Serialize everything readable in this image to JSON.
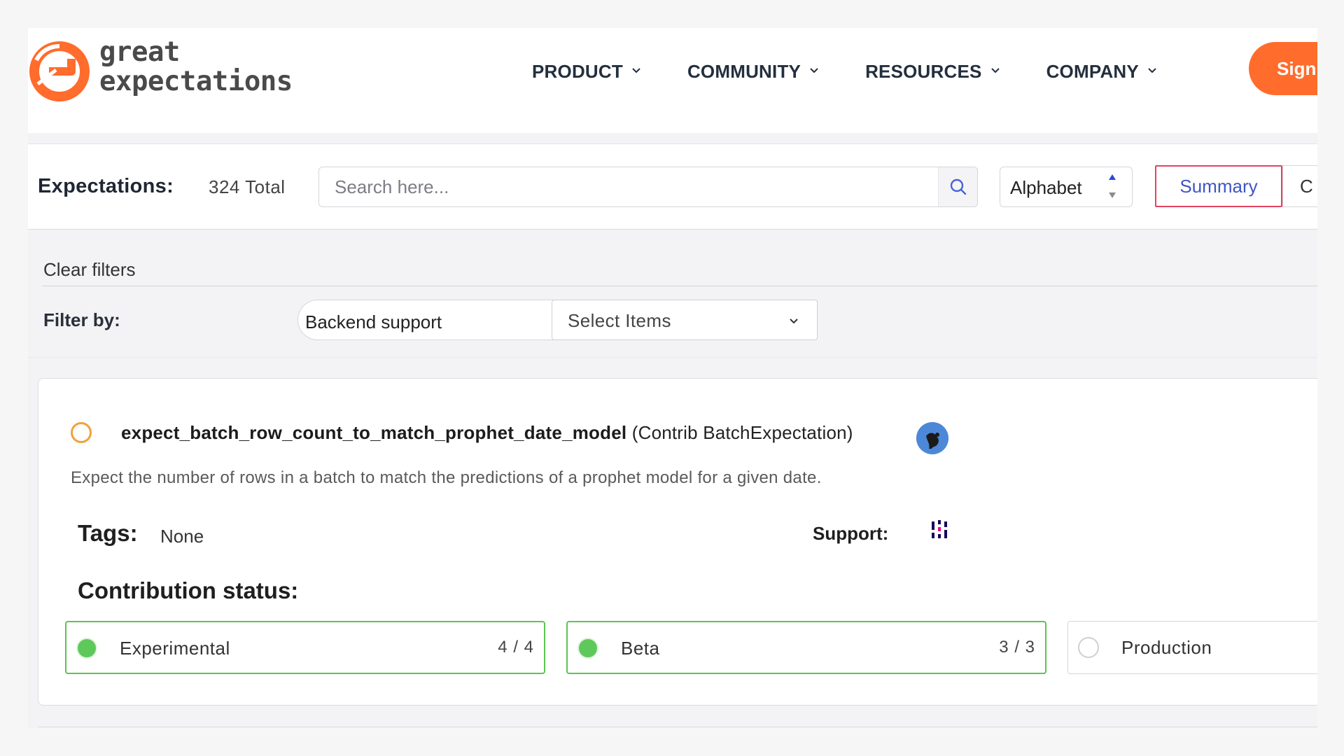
{
  "brand": {
    "line1": "great",
    "line2": "expectations",
    "accent": "#ff6c2c"
  },
  "nav": {
    "items": [
      {
        "label": "PRODUCT"
      },
      {
        "label": "COMMUNITY"
      },
      {
        "label": "RESOURCES"
      },
      {
        "label": "COMPANY"
      }
    ],
    "signin_label": "Sign"
  },
  "toolbar": {
    "title": "Expectations:",
    "total": "324 Total",
    "search_placeholder": "Search here...",
    "sort_label": "Alphabet",
    "view_summary": "Summary",
    "view_compact": "C"
  },
  "filters": {
    "clear_label": "Clear filters",
    "filter_by_label": "Filter by:",
    "backend_label": "Backend support",
    "select_placeholder": "Select Items"
  },
  "expectation": {
    "name": "expect_batch_row_count_to_match_prophet_date_model",
    "type": "(Contrib BatchExpectation)",
    "description": "Expect the number of rows in a batch to match the predictions of a prophet model for a given date.",
    "tags_label": "Tags:",
    "tags_value": "None",
    "support_label": "Support:",
    "contribution_label": "Contribution status:",
    "stages": [
      {
        "label": "Experimental",
        "count": "4 / 4",
        "complete": true
      },
      {
        "label": "Beta",
        "count": "3 / 3",
        "complete": true
      },
      {
        "label": "Production",
        "count": "",
        "complete": false
      }
    ]
  }
}
